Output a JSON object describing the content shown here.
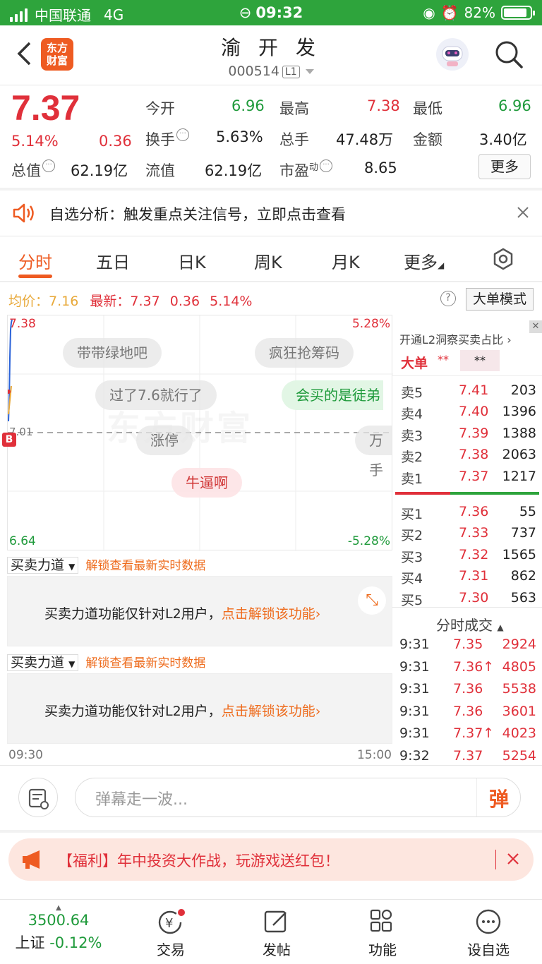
{
  "statusbar": {
    "carrier": "中国联通",
    "network": "4G",
    "time": "09:32",
    "battery": "82%"
  },
  "header": {
    "logo_line1": "东方",
    "logo_line2": "财富",
    "stock_name": "渝 开 发",
    "code": "000514",
    "level": "L1"
  },
  "quote": {
    "price": "7.37",
    "change_pct": "5.14%",
    "change": "0.36",
    "open_label": "今开",
    "open": "6.96",
    "high_label": "最高",
    "high": "7.38",
    "low_label": "最低",
    "low": "6.96",
    "turnover_label": "换手",
    "turnover": "5.63%",
    "volume_label": "总手",
    "volume": "47.48万",
    "amount_label": "金额",
    "amount": "3.40亿",
    "mktcap_label": "总值",
    "mktcap": "62.19亿",
    "float_label": "流值",
    "float": "62.19亿",
    "pe_label": "市盈",
    "pe_sup": "动",
    "pe": "8.65",
    "more": "更多"
  },
  "notice": {
    "text": "自选分析：触发重点关注信号，立即点击查看"
  },
  "tabs": [
    "分时",
    "五日",
    "日K",
    "周K",
    "月K",
    "更多"
  ],
  "chartinfo": {
    "avg_label": "均价：",
    "avg": "7.16",
    "latest_label": "最新：",
    "latest": "7.37",
    "chg": "0.36",
    "pct": "5.14%",
    "mode_btn": "大单模式"
  },
  "chart": {
    "ymax": "7.38",
    "ymin": "6.64",
    "pmax": "5.28%",
    "pmin": "-5.28%",
    "mid": "7.01",
    "time_start": "09:30",
    "time_end": "15:00",
    "bubbles": [
      "带带绿地吧",
      "疯狂抢筹码",
      "过了7.6就行了",
      "会买的是徒弟",
      "涨停",
      "万手",
      "牛逼啊"
    ],
    "watermark": "东方财富",
    "b_marker": "B"
  },
  "power": {
    "label": "买卖力道",
    "unlock": "解锁查看最新实时数据",
    "msg": "买卖力道功能仅针对L2用户，",
    "link": "点击解锁该功能"
  },
  "orderbook": {
    "l2_tip": "开通L2洞察买卖占比",
    "big_label": "大单",
    "big_stars1": "**",
    "big_stars2": "**",
    "sells": [
      {
        "label": "卖5",
        "price": "7.41",
        "vol": "203"
      },
      {
        "label": "卖4",
        "price": "7.40",
        "vol": "1396"
      },
      {
        "label": "卖3",
        "price": "7.39",
        "vol": "1388"
      },
      {
        "label": "卖2",
        "price": "7.38",
        "vol": "2063"
      },
      {
        "label": "卖1",
        "price": "7.37",
        "vol": "1217"
      }
    ],
    "buys": [
      {
        "label": "买1",
        "price": "7.36",
        "vol": "55"
      },
      {
        "label": "买2",
        "price": "7.33",
        "vol": "737"
      },
      {
        "label": "买3",
        "price": "7.32",
        "vol": "1565"
      },
      {
        "label": "买4",
        "price": "7.31",
        "vol": "862"
      },
      {
        "label": "买5",
        "price": "7.30",
        "vol": "563"
      }
    ],
    "ticks_title": "分时成交",
    "ticks": [
      {
        "time": "9:31",
        "price": "7.35",
        "vol": "2924"
      },
      {
        "time": "9:31",
        "price": "7.36↑",
        "vol": "4805"
      },
      {
        "time": "9:31",
        "price": "7.36",
        "vol": "5538"
      },
      {
        "time": "9:31",
        "price": "7.36",
        "vol": "3601"
      },
      {
        "time": "9:31",
        "price": "7.37↑",
        "vol": "4023"
      },
      {
        "time": "9:32",
        "price": "7.37",
        "vol": "5254"
      }
    ]
  },
  "danmu": {
    "placeholder": "弹幕走一波...",
    "send": "弹"
  },
  "welfare": {
    "text": "【福利】年中投资大作战，玩游戏送红包！"
  },
  "nav": {
    "index_value": "3500.64",
    "index_name": "上证",
    "index_chg": "-0.12%",
    "trade": "交易",
    "post": "发帖",
    "func": "功能",
    "fav": "设自选"
  }
}
